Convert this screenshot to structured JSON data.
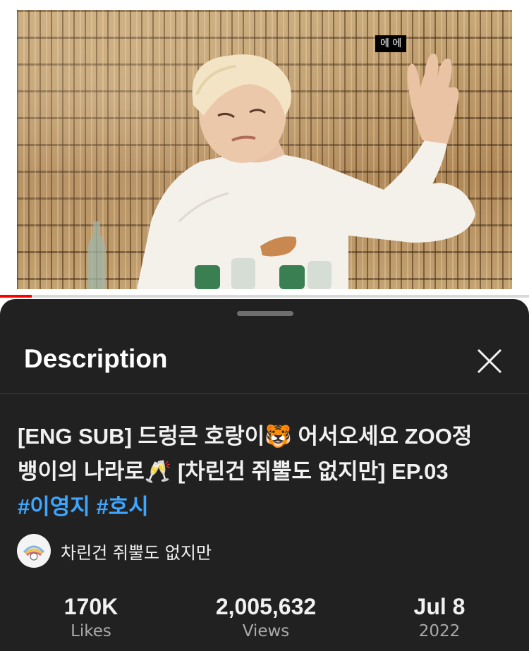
{
  "video": {
    "caption": "에 에",
    "progress_percent": 6
  },
  "sheet": {
    "title": "Description"
  },
  "details": {
    "title_line1": "[ENG SUB] 드렁큰 호랑이🐯 어서오세요 ZOO정",
    "title_line2": "뱅이의 나라로🥂  [차린건 쥐뿔도 없지만] EP.03",
    "hashtags": [
      "#이영지",
      "#호시"
    ],
    "channel_name": "차린건 쥐뿔도 없지만",
    "stats": [
      {
        "value": "170K",
        "label": "Likes"
      },
      {
        "value": "2,005,632",
        "label": "Views"
      },
      {
        "value": "Jul 8",
        "label": "2022"
      }
    ]
  },
  "colors": {
    "sheet_background": "#212121",
    "hashtag": "#3ea6ff",
    "progress": "#ff0000"
  }
}
